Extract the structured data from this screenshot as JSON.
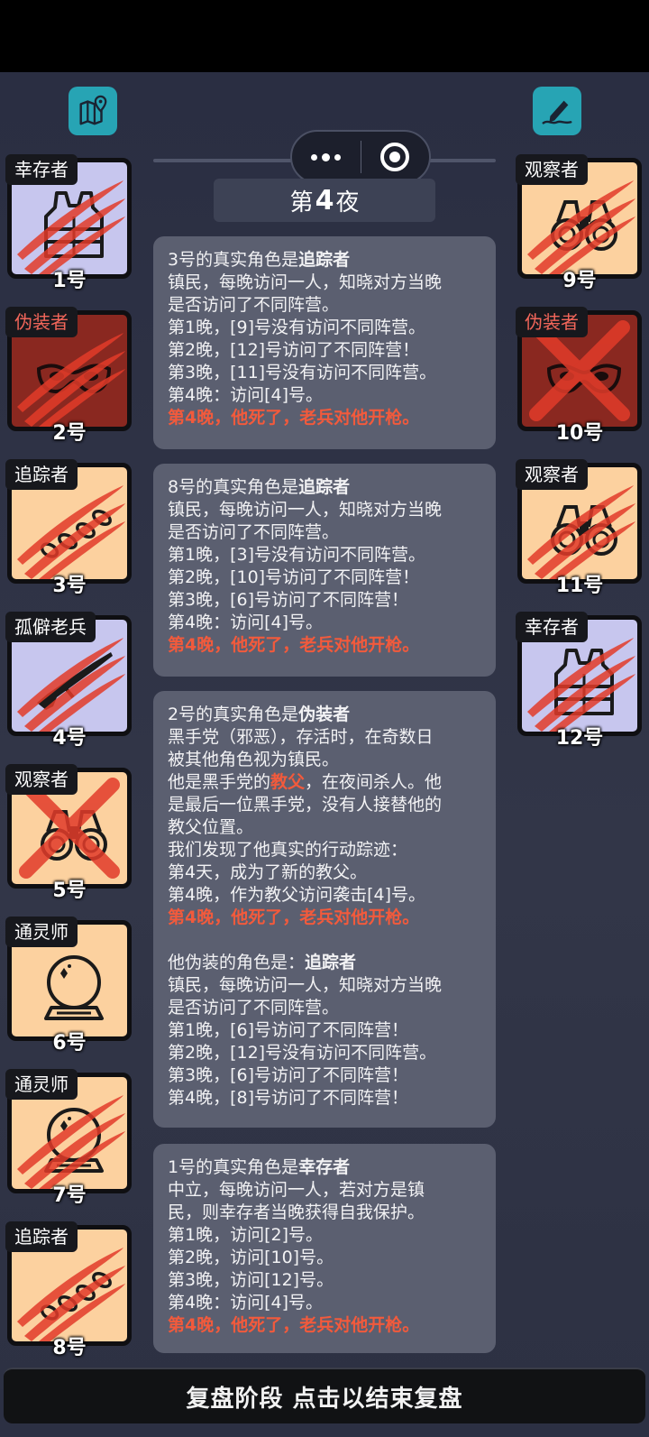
{
  "header": {
    "night_prefix": "第",
    "night_number": "4",
    "night_suffix": "夜",
    "map_icon": "map-pin-icon",
    "note_icon": "edit-note-icon",
    "menu_icon": "more-dots-icon",
    "close_icon": "target-circle-icon"
  },
  "players_left": [
    {
      "role": "幸存者",
      "number": "1号",
      "bg": "#c7c6ee",
      "icon": "vest-icon",
      "status": "clawed",
      "role_color": "#ffffff"
    },
    {
      "role": "伪装者",
      "number": "2号",
      "bg": "#8a2820",
      "icon": "mask-icon",
      "status": "clawed",
      "role_color": "#f2665a"
    },
    {
      "role": "追踪者",
      "number": "3号",
      "bg": "#fcd19f",
      "icon": "footprints-icon",
      "status": "clawed",
      "role_color": "#ffffff"
    },
    {
      "role": "孤僻老兵",
      "number": "4号",
      "bg": "#c7c6ee",
      "icon": "rifle-icon",
      "status": "clawed",
      "role_color": "#ffffff"
    },
    {
      "role": "观察者",
      "number": "5号",
      "bg": "#fcd19f",
      "icon": "binoculars-icon",
      "status": "crossed",
      "role_color": "#ffffff"
    },
    {
      "role": "通灵师",
      "number": "6号",
      "bg": "#fcd19f",
      "icon": "crystal-ball-icon",
      "status": "alive",
      "role_color": "#ffffff"
    },
    {
      "role": "通灵师",
      "number": "7号",
      "bg": "#fcd19f",
      "icon": "crystal-ball-icon",
      "status": "clawed",
      "role_color": "#ffffff"
    },
    {
      "role": "追踪者",
      "number": "8号",
      "bg": "#fcd19f",
      "icon": "footprints-icon",
      "status": "clawed",
      "role_color": "#ffffff"
    }
  ],
  "players_right": [
    {
      "role": "观察者",
      "number": "9号",
      "bg": "#fcd19f",
      "icon": "binoculars-icon",
      "status": "clawed",
      "role_color": "#ffffff"
    },
    {
      "role": "伪装者",
      "number": "10号",
      "bg": "#8a2820",
      "icon": "mask-icon",
      "status": "crossed",
      "role_color": "#f2665a"
    },
    {
      "role": "观察者",
      "number": "11号",
      "bg": "#fcd19f",
      "icon": "binoculars-icon",
      "status": "clawed",
      "role_color": "#ffffff"
    },
    {
      "role": "幸存者",
      "number": "12号",
      "bg": "#c7c6ee",
      "icon": "vest-icon",
      "status": "clawed",
      "role_color": "#ffffff"
    }
  ],
  "cards": [
    {
      "title_prefix": "3号的真实角色是",
      "title_role": "追踪者",
      "lines": [
        "镇民，每晚访问一人，知晓对方当晚",
        "是否访问了不同阵营。",
        "第1晚，[9]号没有访问不同阵营。",
        "第2晚，[12]号访问了不同阵营！",
        "第3晚，[11]号没有访问不同阵营。",
        "第4晚：访问[4]号。"
      ],
      "death": "第4晚，他死了，老兵对他开枪。"
    },
    {
      "title_prefix": "8号的真实角色是",
      "title_role": "追踪者",
      "lines": [
        "镇民，每晚访问一人，知晓对方当晚",
        "是否访问了不同阵营。",
        "第1晚，[3]号没有访问不同阵营。",
        "第2晚，[10]号访问了不同阵营！",
        "第3晚，[6]号访问了不同阵营！",
        "第4晚：访问[4]号。"
      ],
      "death": "第4晚，他死了，老兵对他开枪。"
    },
    {
      "title_prefix": "2号的真实角色是",
      "title_role": "伪装者",
      "lines_a": [
        "黑手党（邪恶），存活时，在奇数日",
        "被其他角色视为镇民。"
      ],
      "godfather_pre": "他是黑手党的",
      "godfather_word": "教父",
      "godfather_post": "，在夜间杀人。他",
      "lines_b": [
        "是最后一位黑手党，没有人接替他的",
        "教父位置。",
        "我们发现了他真实的行动踪迹：",
        "第4天，成为了新的教父。",
        "第4晚，作为教父访问袭击[4]号。"
      ],
      "death": "第4晚，他死了，老兵对他开枪。",
      "disguise_prefix": "他伪装的角色是：",
      "disguise_role": "追踪者",
      "lines_c": [
        "镇民，每晚访问一人，知晓对方当晚",
        "是否访问了不同阵营。",
        "第1晚，[6]号访问了不同阵营！",
        "第2晚，[12]号没有访问不同阵营。",
        "第3晚，[6]号访问了不同阵营！",
        "第4晚，[8]号访问了不同阵营！"
      ]
    },
    {
      "title_prefix": "1号的真实角色是",
      "title_role": "幸存者",
      "lines": [
        "中立，每晚访问一人，若对方是镇",
        "民，则幸存者当晚获得自我保护。",
        "第1晚，访问[2]号。",
        "第2晚，访问[10]号。",
        "第3晚，访问[12]号。",
        "第4晚：访问[4]号。"
      ],
      "death": "第4晚，他死了，老兵对他开枪。"
    }
  ],
  "footer": {
    "label": "复盘阶段 点击以结束复盘"
  }
}
